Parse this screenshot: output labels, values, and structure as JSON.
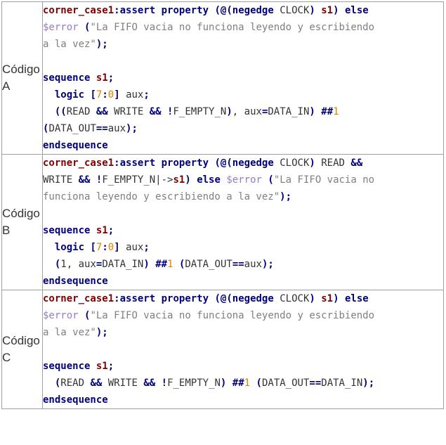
{
  "rows": [
    {
      "label_line1": "Código",
      "label_line2": "A",
      "lines": [
        [
          [
            "id",
            "corner_case1"
          ],
          [
            "op",
            ":"
          ],
          [
            "kw",
            "assert"
          ],
          [
            "pl",
            " "
          ],
          [
            "kw",
            "property"
          ],
          [
            "pl",
            " "
          ],
          [
            "op",
            "(@("
          ],
          [
            "kw",
            "negedge"
          ],
          [
            "pl",
            " CLOCK"
          ],
          [
            "op",
            ")"
          ],
          [
            "pl",
            " "
          ],
          [
            "id",
            "s1"
          ],
          [
            "op",
            ")"
          ],
          [
            "pl",
            " "
          ],
          [
            "kw",
            "else"
          ]
        ],
        [
          [
            "var",
            "$error"
          ],
          [
            "pl",
            " "
          ],
          [
            "op",
            "("
          ],
          [
            "str",
            "\"La FIFO vacia no funciona leyendo y escribiendo"
          ]
        ],
        [
          [
            "str",
            "a la vez\""
          ],
          [
            "op",
            ");"
          ]
        ],
        [],
        [
          [
            "kw",
            "sequence"
          ],
          [
            "pl",
            " "
          ],
          [
            "id",
            "s1"
          ],
          [
            "op",
            ";"
          ]
        ],
        [
          [
            "pl",
            "  "
          ],
          [
            "kw",
            "logic"
          ],
          [
            "pl",
            " "
          ],
          [
            "op",
            "["
          ],
          [
            "num",
            "7"
          ],
          [
            "op",
            ":"
          ],
          [
            "num",
            "0"
          ],
          [
            "op",
            "]"
          ],
          [
            "pl",
            " aux"
          ],
          [
            "op",
            ";"
          ]
        ],
        [
          [
            "pl",
            "  "
          ],
          [
            "op",
            "(("
          ],
          [
            "pl",
            "READ "
          ],
          [
            "op",
            "&&"
          ],
          [
            "pl",
            " WRITE "
          ],
          [
            "op",
            "&&"
          ],
          [
            "pl",
            " "
          ],
          [
            "op",
            "!"
          ],
          [
            "pl",
            "F_EMPTY_N"
          ],
          [
            "op",
            ")"
          ],
          [
            "pl",
            ", aux"
          ],
          [
            "op",
            "="
          ],
          [
            "pl",
            "DATA_IN"
          ],
          [
            "op",
            ")"
          ],
          [
            "pl",
            " "
          ],
          [
            "op",
            "##"
          ],
          [
            "num",
            "1"
          ]
        ],
        [
          [
            "op",
            "("
          ],
          [
            "pl",
            "DATA_OUT"
          ],
          [
            "op",
            "=="
          ],
          [
            "pl",
            "aux"
          ],
          [
            "op",
            ");"
          ]
        ],
        [
          [
            "kw",
            "endsequence"
          ]
        ]
      ]
    },
    {
      "label_line1": "Código",
      "label_line2": "B",
      "lines": [
        [
          [
            "id",
            "corner_case1"
          ],
          [
            "op",
            ":"
          ],
          [
            "kw",
            "assert"
          ],
          [
            "pl",
            " "
          ],
          [
            "kw",
            "property"
          ],
          [
            "pl",
            " "
          ],
          [
            "op",
            "(@("
          ],
          [
            "kw",
            "negedge"
          ],
          [
            "pl",
            " CLOCK"
          ],
          [
            "op",
            ")"
          ],
          [
            "pl",
            " READ "
          ],
          [
            "op",
            "&&"
          ]
        ],
        [
          [
            "pl",
            "WRITE "
          ],
          [
            "op",
            "&&"
          ],
          [
            "pl",
            " "
          ],
          [
            "op",
            "!"
          ],
          [
            "pl",
            "F_EMPTY_N|->"
          ],
          [
            "id",
            "s1"
          ],
          [
            "op",
            ")"
          ],
          [
            "pl",
            " "
          ],
          [
            "kw",
            "else"
          ],
          [
            "pl",
            " "
          ],
          [
            "var",
            "$error"
          ],
          [
            "pl",
            " "
          ],
          [
            "op",
            "("
          ],
          [
            "str",
            "\"La FIFO vacia no"
          ]
        ],
        [
          [
            "str",
            "funciona leyendo y escribiendo a la vez\""
          ],
          [
            "op",
            ");"
          ]
        ],
        [],
        [
          [
            "kw",
            "sequence"
          ],
          [
            "pl",
            " "
          ],
          [
            "id",
            "s1"
          ],
          [
            "op",
            ";"
          ]
        ],
        [
          [
            "pl",
            "  "
          ],
          [
            "kw",
            "logic"
          ],
          [
            "pl",
            " "
          ],
          [
            "op",
            "["
          ],
          [
            "num",
            "7"
          ],
          [
            "op",
            ":"
          ],
          [
            "num",
            "0"
          ],
          [
            "op",
            "]"
          ],
          [
            "pl",
            " aux"
          ],
          [
            "op",
            ";"
          ]
        ],
        [
          [
            "pl",
            "  "
          ],
          [
            "op",
            "("
          ],
          [
            "pl",
            "1, aux"
          ],
          [
            "op",
            "="
          ],
          [
            "pl",
            "DATA_IN"
          ],
          [
            "op",
            ")"
          ],
          [
            "pl",
            " "
          ],
          [
            "op",
            "##"
          ],
          [
            "num",
            "1"
          ],
          [
            "pl",
            " "
          ],
          [
            "op",
            "("
          ],
          [
            "pl",
            "DATA_OUT"
          ],
          [
            "op",
            "=="
          ],
          [
            "pl",
            "aux"
          ],
          [
            "op",
            ");"
          ]
        ],
        [
          [
            "kw",
            "endsequence"
          ]
        ]
      ]
    },
    {
      "label_line1": "Código",
      "label_line2": "C",
      "lines": [
        [
          [
            "id",
            "corner_case1"
          ],
          [
            "op",
            ":"
          ],
          [
            "kw",
            "assert"
          ],
          [
            "pl",
            " "
          ],
          [
            "kw",
            "property"
          ],
          [
            "pl",
            " "
          ],
          [
            "op",
            "(@("
          ],
          [
            "kw",
            "negedge"
          ],
          [
            "pl",
            " CLOCK"
          ],
          [
            "op",
            ")"
          ],
          [
            "pl",
            " "
          ],
          [
            "id",
            "s1"
          ],
          [
            "op",
            ")"
          ],
          [
            "pl",
            " "
          ],
          [
            "kw",
            "else"
          ]
        ],
        [
          [
            "var",
            "$error"
          ],
          [
            "pl",
            " "
          ],
          [
            "op",
            "("
          ],
          [
            "str",
            "\"La FIFO vacia no funciona leyendo y escribiendo"
          ]
        ],
        [
          [
            "str",
            "a la vez\""
          ],
          [
            "op",
            ");"
          ]
        ],
        [],
        [
          [
            "kw",
            "sequence"
          ],
          [
            "pl",
            " "
          ],
          [
            "id",
            "s1"
          ],
          [
            "op",
            ";"
          ]
        ],
        [
          [
            "pl",
            "  "
          ],
          [
            "op",
            "("
          ],
          [
            "pl",
            "READ "
          ],
          [
            "op",
            "&&"
          ],
          [
            "pl",
            " WRITE "
          ],
          [
            "op",
            "&&"
          ],
          [
            "pl",
            " "
          ],
          [
            "op",
            "!"
          ],
          [
            "pl",
            "F_EMPTY_N"
          ],
          [
            "op",
            ")"
          ],
          [
            "pl",
            " "
          ],
          [
            "op",
            "##"
          ],
          [
            "num",
            "1"
          ],
          [
            "pl",
            " "
          ],
          [
            "op",
            "("
          ],
          [
            "pl",
            "DATA_OUT"
          ],
          [
            "op",
            "=="
          ],
          [
            "pl",
            "DATA_IN"
          ],
          [
            "op",
            ");"
          ]
        ],
        [
          [
            "kw",
            "endsequence"
          ]
        ]
      ]
    }
  ]
}
